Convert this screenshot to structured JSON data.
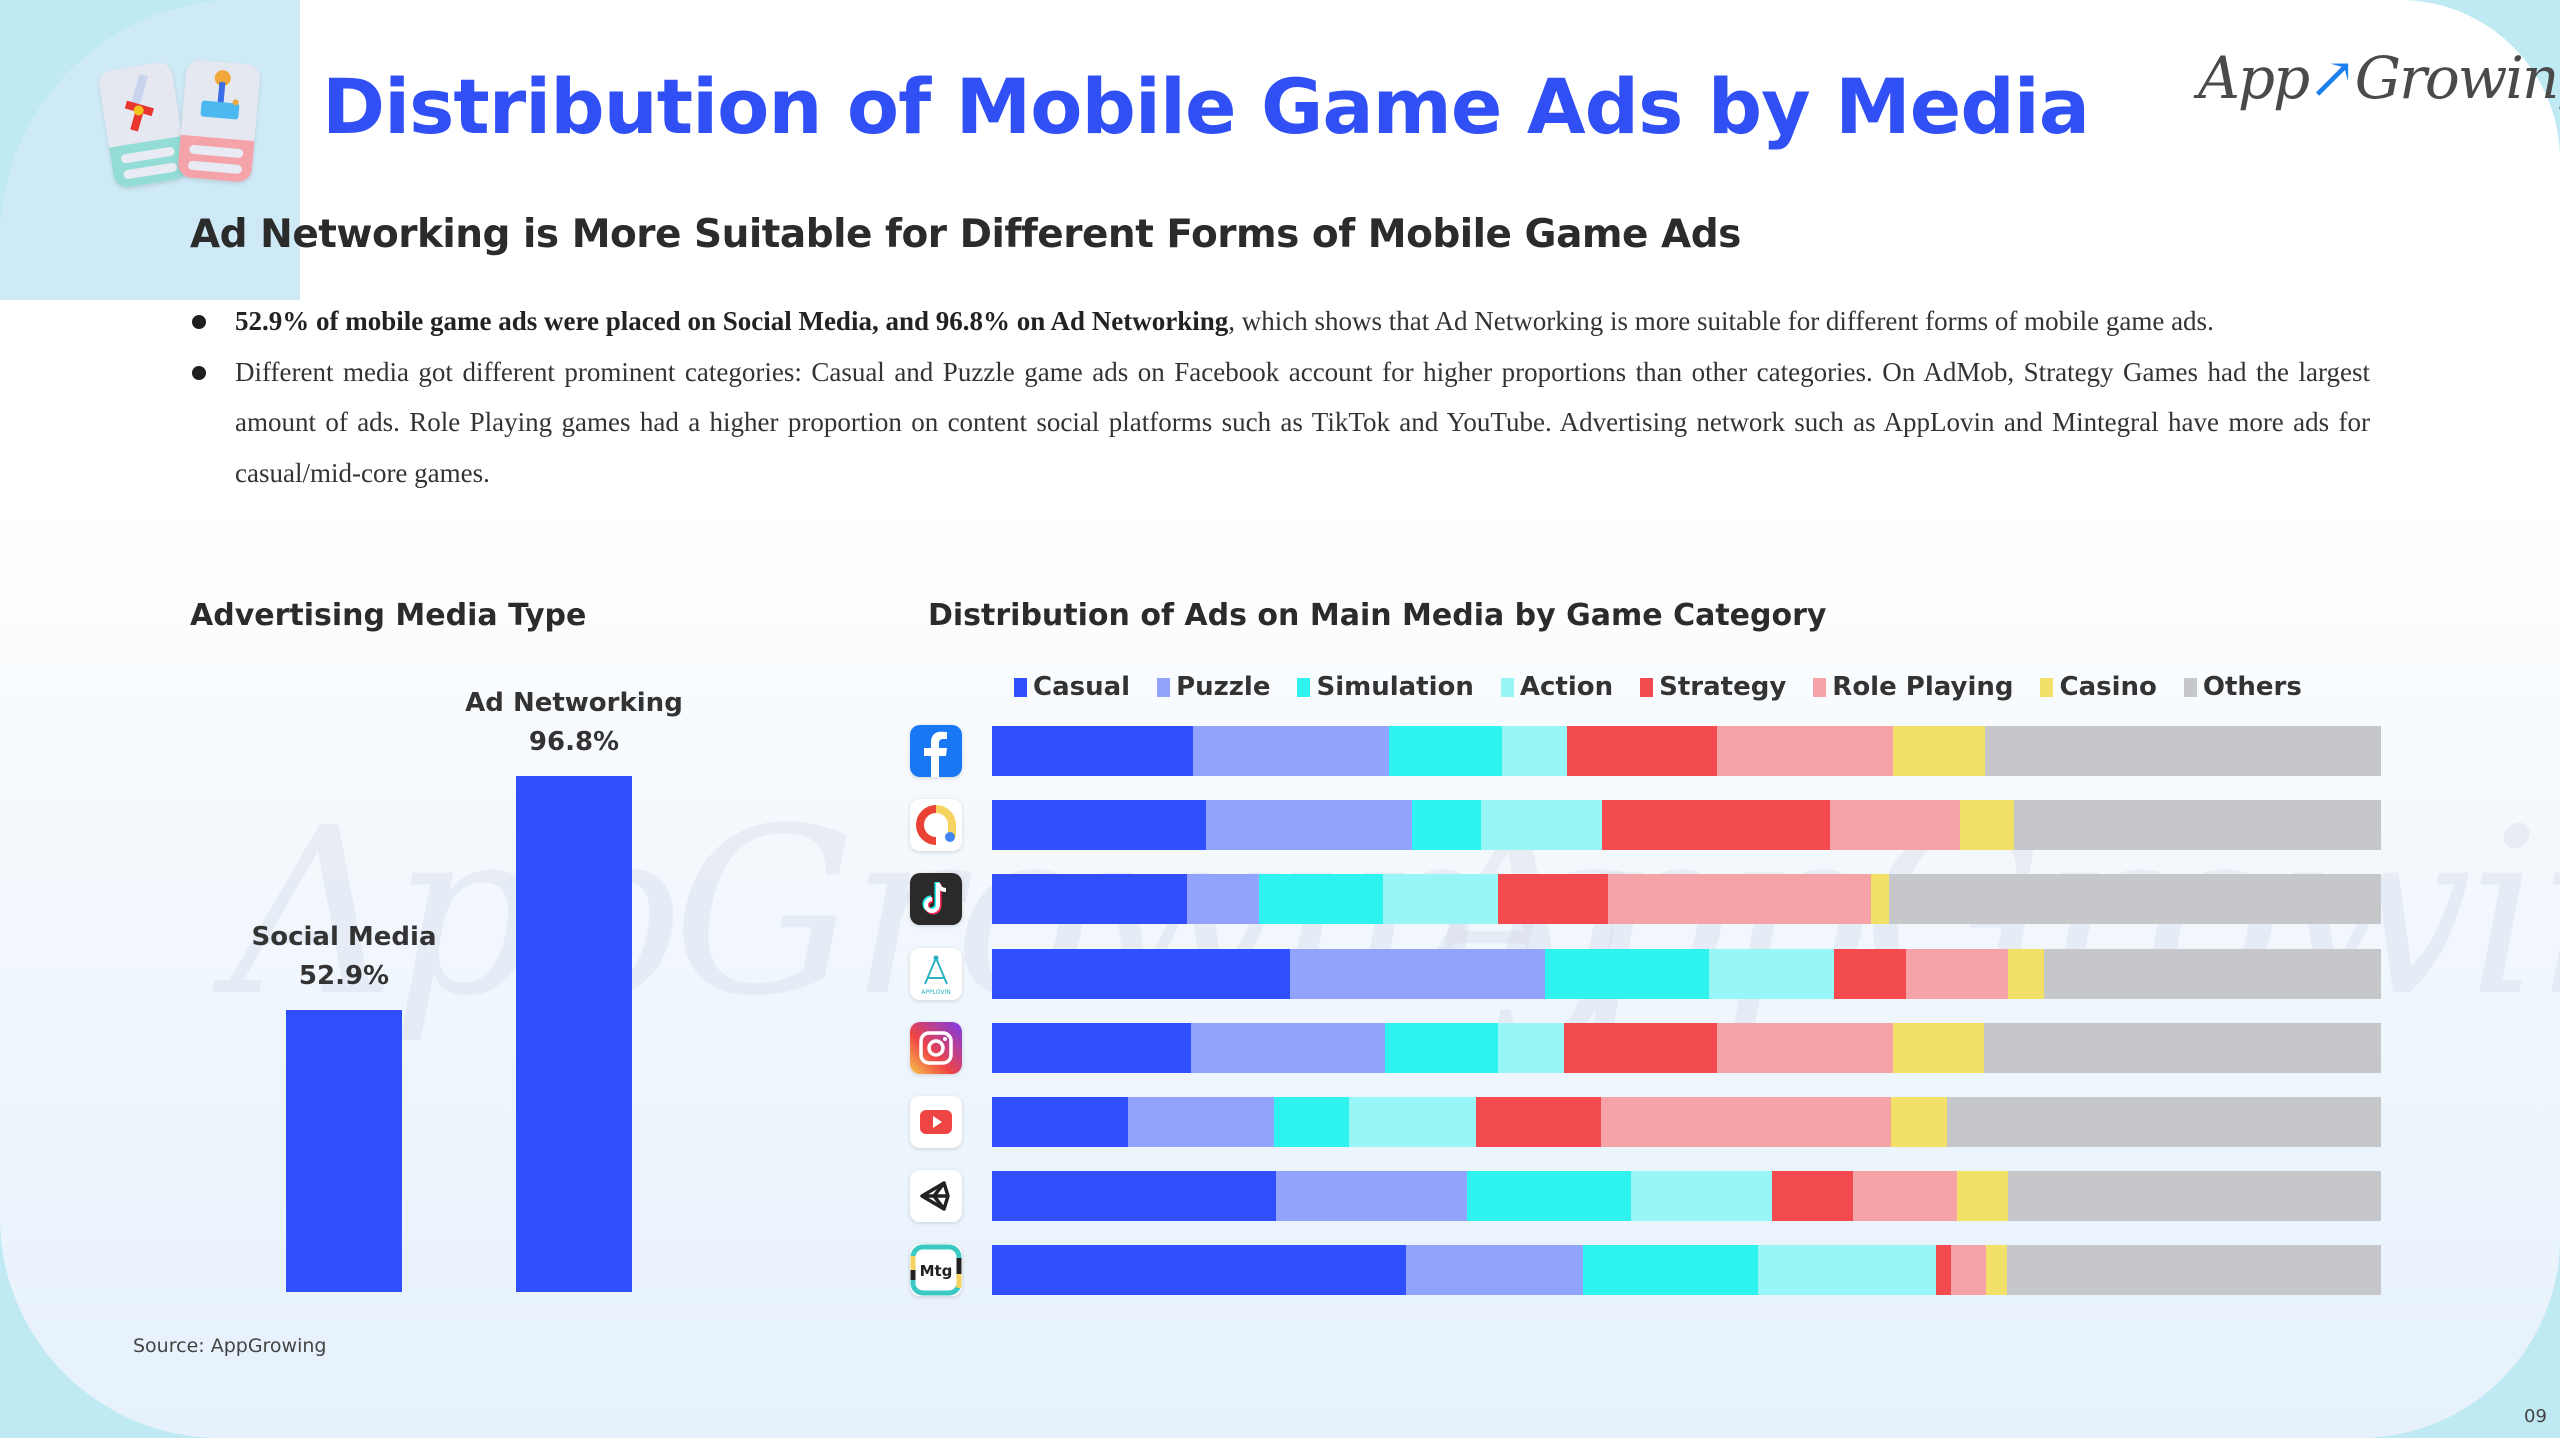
{
  "header": {
    "title": "Distribution of Mobile Game Ads by Media",
    "brand_logo_left": "App",
    "brand_logo_right": "Growing",
    "subtitle": "Ad Networking is More Suitable for Different Forms of Mobile Game Ads"
  },
  "bullets": [
    {
      "bold": "52.9% of mobile game ads were placed on Social Media, and 96.8% on Ad Networking",
      "text": ", which shows that Ad Networking is more suitable for different forms of mobile game ads."
    },
    {
      "bold": "",
      "text": "Different media got different prominent categories: Casual and Puzzle game ads on Facebook account for higher proportions than other categories. On AdMob, Strategy Games had the largest amount of ads. Role Playing games had a higher proportion on content social platforms such as TikTok and YouTube. Advertising network such as AppLovin and Mintegral have more ads for casual/mid-core games."
    }
  ],
  "footer": {
    "source": "Source: AppGrowing",
    "page_number": "09"
  },
  "watermark": "AppGrowing",
  "colors": {
    "title": "#3050f5",
    "bar": "#304ffe"
  },
  "chart_data": [
    {
      "type": "bar",
      "title": "Advertising Media Type",
      "categories": [
        "Social Media",
        "Ad Networking"
      ],
      "values": [
        52.9,
        96.8
      ],
      "value_labels": [
        "52.9%",
        "96.8%"
      ],
      "unit": "%",
      "ylim": [
        0,
        100
      ],
      "grid": false,
      "xlabel": "",
      "ylabel": ""
    },
    {
      "type": "bar",
      "orientation": "horizontal",
      "stacked": true,
      "normalized": true,
      "title": "Distribution of Ads on Main Media by Game Category",
      "categories": [
        {
          "name": "Facebook",
          "icon": "facebook-icon"
        },
        {
          "name": "AdMob",
          "icon": "admob-icon"
        },
        {
          "name": "TikTok",
          "icon": "tiktok-icon"
        },
        {
          "name": "AppLovin",
          "icon": "applovin-icon",
          "icon_text": "APPLOVIN"
        },
        {
          "name": "Instagram",
          "icon": "instagram-icon"
        },
        {
          "name": "YouTube",
          "icon": "youtube-icon"
        },
        {
          "name": "Unity",
          "icon": "unity-icon"
        },
        {
          "name": "Mintegral",
          "icon": "mintegral-icon",
          "icon_text": "Mtg"
        }
      ],
      "legend_position": "top",
      "xlim": [
        0,
        100
      ],
      "unit": "%",
      "series": [
        {
          "name": "Casual",
          "color": "#304ffe",
          "values": [
            14.5,
            15.4,
            14.0,
            21.4,
            14.3,
            9.8,
            20.5,
            29.8
          ]
        },
        {
          "name": "Puzzle",
          "color": "#91a3fc",
          "values": [
            14.1,
            14.8,
            5.2,
            18.3,
            14.0,
            10.5,
            13.8,
            12.7
          ]
        },
        {
          "name": "Simulation",
          "color": "#2ff3ef",
          "values": [
            8.1,
            5.0,
            8.9,
            11.8,
            8.1,
            5.4,
            11.8,
            12.6
          ]
        },
        {
          "name": "Action",
          "color": "#98f6f6",
          "values": [
            4.7,
            8.7,
            8.3,
            9.0,
            4.8,
            9.2,
            10.2,
            12.8
          ]
        },
        {
          "name": "Strategy",
          "color": "#f24a4e",
          "values": [
            10.8,
            16.4,
            7.9,
            5.2,
            11.0,
            9.0,
            5.8,
            1.1
          ]
        },
        {
          "name": "Role Playing",
          "color": "#f6a3a8",
          "values": [
            12.7,
            9.3,
            18.9,
            7.3,
            12.7,
            20.9,
            7.5,
            2.5
          ]
        },
        {
          "name": "Casino",
          "color": "#f2e068",
          "values": [
            6.6,
            3.9,
            1.3,
            2.6,
            6.5,
            4.0,
            3.7,
            1.5
          ]
        },
        {
          "name": "Others",
          "color": "#c6c7cb",
          "values": [
            28.5,
            26.4,
            35.4,
            24.2,
            28.6,
            31.3,
            26.9,
            26.9
          ]
        }
      ]
    }
  ]
}
